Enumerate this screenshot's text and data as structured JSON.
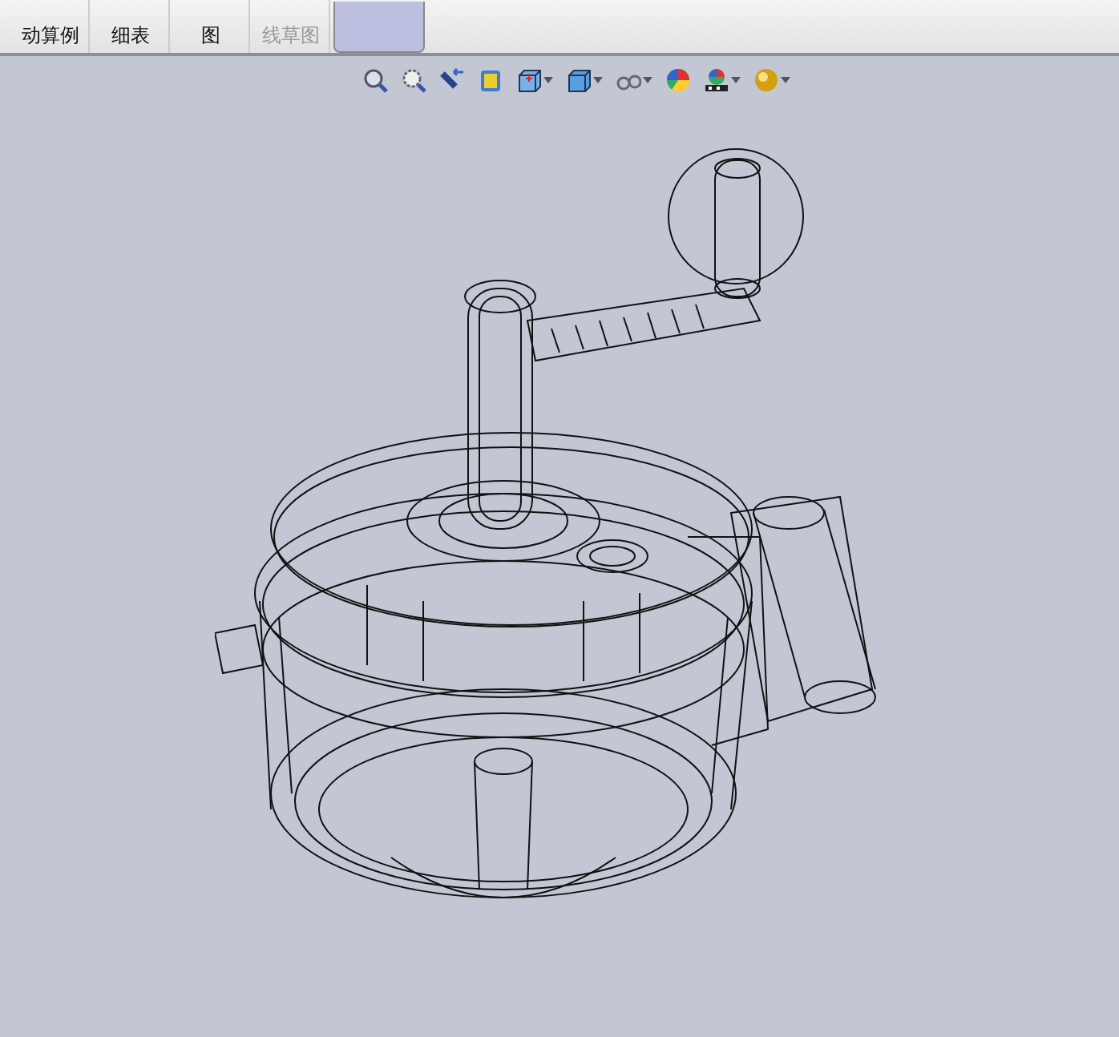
{
  "command_tabs": [
    {
      "label": "动算例",
      "selected": false,
      "disabled": false
    },
    {
      "label": "细表",
      "selected": false,
      "disabled": false
    },
    {
      "label": "图",
      "selected": false,
      "disabled": false
    },
    {
      "label": "线草图",
      "selected": false,
      "disabled": true
    },
    {
      "selected": true,
      "disabled": false
    }
  ],
  "view_tools": [
    {
      "kind": "zoom-fit",
      "dropdown": false
    },
    {
      "kind": "zoom-area",
      "dropdown": false
    },
    {
      "kind": "previous",
      "dropdown": false
    },
    {
      "kind": "section",
      "dropdown": false
    },
    {
      "kind": "orientation",
      "dropdown": true
    },
    {
      "kind": "display",
      "dropdown": true
    },
    {
      "kind": "hide",
      "dropdown": true
    },
    {
      "kind": "appearance",
      "dropdown": false
    },
    {
      "kind": "scene",
      "dropdown": true
    },
    {
      "kind": "sphere",
      "dropdown": true
    }
  ]
}
